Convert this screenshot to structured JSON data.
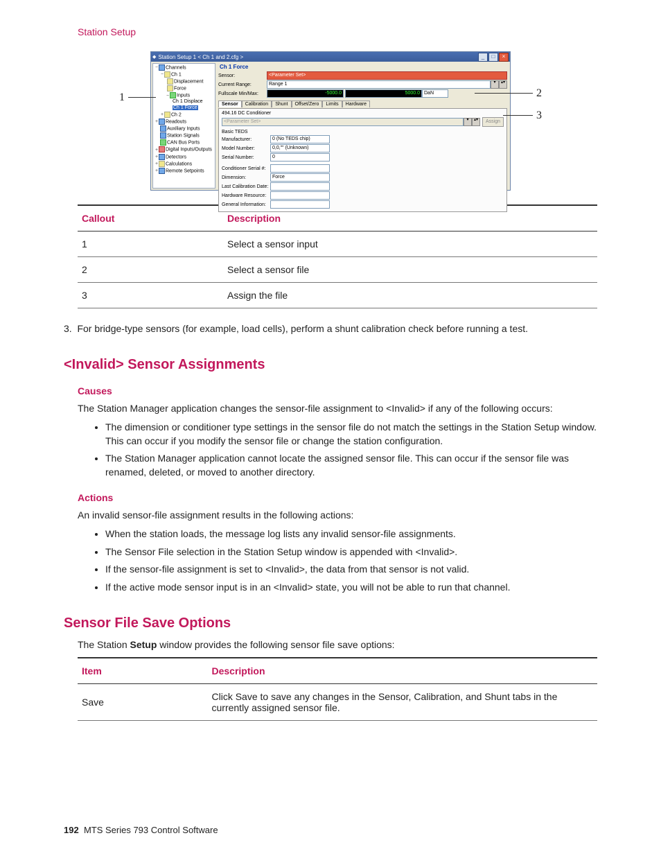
{
  "header": {
    "section": "Station Setup"
  },
  "figure": {
    "callouts": {
      "c1": "1",
      "c2": "2",
      "c3": "3"
    },
    "window_title": "Station Setup 1 < Ch 1 and 2.cfg >",
    "tree": {
      "channels": "Channels",
      "ch1": "Ch 1",
      "displacement": "Displacement",
      "force": "Force",
      "inputs": "Inputs",
      "ch1_displace": "Ch 1 Displace",
      "ch1_force": "Ch 1 Force",
      "ch2": "Ch 2",
      "readouts": "Readouts",
      "aux_inputs": "Auxiliary Inputs",
      "station_signals": "Station Signals",
      "can_bus": "CAN Bus Ports",
      "digital_io": "Digital Inputs/Outputs",
      "detectors": "Detectors",
      "calculations": "Calculations",
      "remote_setpoints": "Remote Setpoints"
    },
    "pane": {
      "title": "Ch 1 Force",
      "sensor_label": "Sensor:",
      "sensor_value": "<Parameter Set>",
      "range_label": "Current Range:",
      "range_value": "Range 1",
      "minmax_label": "Fullscale Min/Max:",
      "min_value": "-5000.0",
      "max_value": "5000.0",
      "unit": "DaN",
      "tabs": {
        "sensor": "Sensor",
        "calibration": "Calibration",
        "shunt": "Shunt",
        "offset": "Offset/Zero",
        "limits": "Limits",
        "hardware": "Hardware"
      },
      "conditioner": "494.16 DC Conditioner",
      "param_set": "<Parameter Set>",
      "assign_btn": "Assign",
      "teds_label": "Basic TEDS",
      "manufacturer_label": "Manufacturer:",
      "manufacturer_value": "0 (No TEDS chip)",
      "model_label": "Model Number:",
      "model_value": "0,0,\"\" (Unknown)",
      "serial_label": "Serial Number:",
      "serial_value": "0",
      "cond_serial_label": "Conditioner Serial #:",
      "dimension_label": "Dimension:",
      "dimension_value": "Force",
      "lastcal_label": "Last Calibration Date:",
      "hwres_label": "Hardware Resource:",
      "geninfo_label": "General Information:"
    }
  },
  "callout_table": {
    "h1": "Callout",
    "h2": "Description",
    "r1c1": "1",
    "r1c2": "Select a sensor input",
    "r2c1": "2",
    "r2c2": "Select a sensor file",
    "r3c1": "3",
    "r3c2": "Assign the file"
  },
  "step3": "For bridge-type sensors (for example, load cells), perform a shunt calibration check before running a test.",
  "invalid_section": {
    "heading": "<Invalid> Sensor Assignments",
    "causes_h": "Causes",
    "causes_intro": "The Station Manager application changes the sensor-file assignment to <Invalid> if any of the following occurs:",
    "cause1": "The dimension or conditioner type settings in the sensor file do not match the settings in the Station Setup window. This can occur if you modify the sensor file or change the station configuration.",
    "cause2": "The Station Manager application cannot locate the assigned sensor file. This can occur if the sensor file was renamed, deleted, or moved to another directory.",
    "actions_h": "Actions",
    "actions_intro": "An invalid sensor-file assignment results in the following actions:",
    "action1": "When the station loads, the message log lists any invalid sensor-file assignments.",
    "action2": "The Sensor File selection in the Station Setup window is appended with <Invalid>.",
    "action3": "If the sensor-file assignment is set to <Invalid>, the data from that sensor is not valid.",
    "action4": "If the active mode sensor input is in an <Invalid> state, you will not be able to run that channel."
  },
  "save_section": {
    "heading": "Sensor File Save Options",
    "intro_pre": "The Station ",
    "intro_bold": "Setup",
    "intro_post": " window provides the following sensor file save options:",
    "h1": "Item",
    "h2": "Description",
    "r1c1": "Save",
    "r1c2": "Click Save to save any changes in the Sensor, Calibration, and Shunt tabs in the currently assigned sensor file."
  },
  "footer": {
    "page": "192",
    "doc": "MTS Series 793 Control Software"
  }
}
